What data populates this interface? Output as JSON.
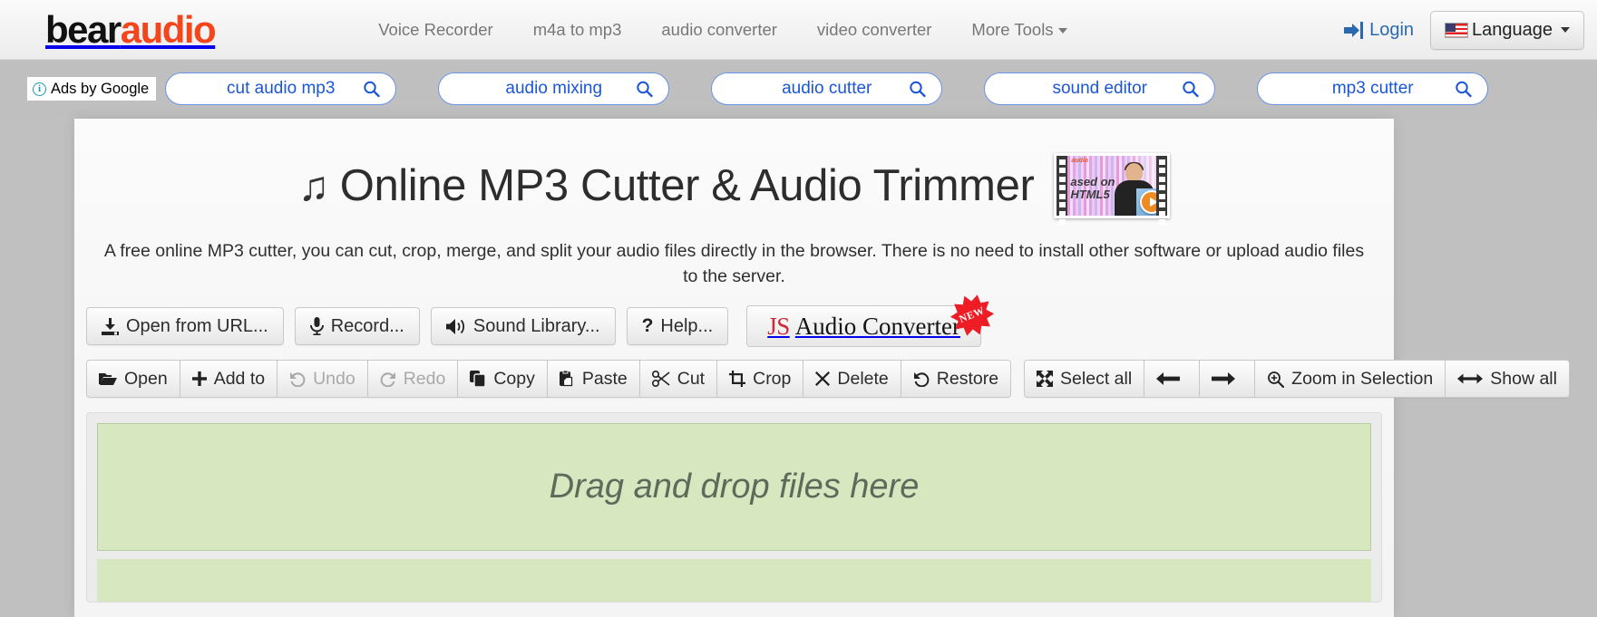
{
  "navbar": {
    "brand_first": "bear",
    "brand_second": "audio",
    "links": [
      {
        "label": "Voice Recorder"
      },
      {
        "label": "m4a to mp3"
      },
      {
        "label": "audio converter"
      },
      {
        "label": "video converter"
      },
      {
        "label": "More Tools"
      }
    ],
    "login_label": "Login",
    "language_label": "Language"
  },
  "ads": {
    "ads_by_google": "Ads by Google",
    "pills": [
      {
        "query": "cut audio mp3"
      },
      {
        "query": "audio mixing"
      },
      {
        "query": "audio cutter"
      },
      {
        "query": "sound editor"
      },
      {
        "query": "mp3 cutter"
      }
    ]
  },
  "hero": {
    "title": "Online MP3 Cutter & Audio Trimmer",
    "note_glyph": "♫",
    "description": "A free online MP3 cutter, you can cut, crop, merge, and split your audio files directly in the browser. There is no need to install other software or upload audio files to the server.",
    "video_thumb": {
      "caption_line1": "ased on",
      "caption_line2": "HTML5",
      "watermark": "audio"
    }
  },
  "actions": {
    "open_from_url": "Open from URL...",
    "record": "Record...",
    "sound_library": "Sound Library...",
    "help": "Help...",
    "js_audio_converter_js": "JS",
    "js_audio_converter_rest": "Audio Converter",
    "new_badge": "NEW"
  },
  "toolbar": {
    "group1": [
      {
        "label": "Open",
        "icon": "folder-open-icon",
        "disabled": false
      },
      {
        "label": "Add to",
        "icon": "plus-icon",
        "disabled": false
      },
      {
        "label": "Undo",
        "icon": "undo-icon",
        "disabled": true
      },
      {
        "label": "Redo",
        "icon": "redo-icon",
        "disabled": true
      },
      {
        "label": "Copy",
        "icon": "copy-icon",
        "disabled": false
      },
      {
        "label": "Paste",
        "icon": "paste-icon",
        "disabled": false
      },
      {
        "label": "Cut",
        "icon": "scissors-icon",
        "disabled": false
      },
      {
        "label": "Crop",
        "icon": "crop-icon",
        "disabled": false
      },
      {
        "label": "Delete",
        "icon": "x-icon",
        "disabled": false
      },
      {
        "label": "Restore",
        "icon": "restore-icon",
        "disabled": false
      }
    ],
    "group2": [
      {
        "label": "Select all",
        "icon": "expand-icon",
        "disabled": false
      },
      {
        "label": "",
        "icon": "arrow-left-icon",
        "disabled": false
      },
      {
        "label": "",
        "icon": "arrow-right-icon",
        "disabled": false
      },
      {
        "label": "Zoom in Selection",
        "icon": "zoom-in-icon",
        "disabled": false
      },
      {
        "label": "Show all",
        "icon": "arrows-h-icon",
        "disabled": false
      }
    ]
  },
  "editor": {
    "dropzone_text": "Drag and drop files here"
  },
  "colors": {
    "brand_orange": "#f4461c",
    "link_blue": "#2a69b0",
    "ad_blue": "#1a56d6",
    "dropzone_green": "#d7e7c0",
    "new_badge_red": "#ee1c25"
  }
}
